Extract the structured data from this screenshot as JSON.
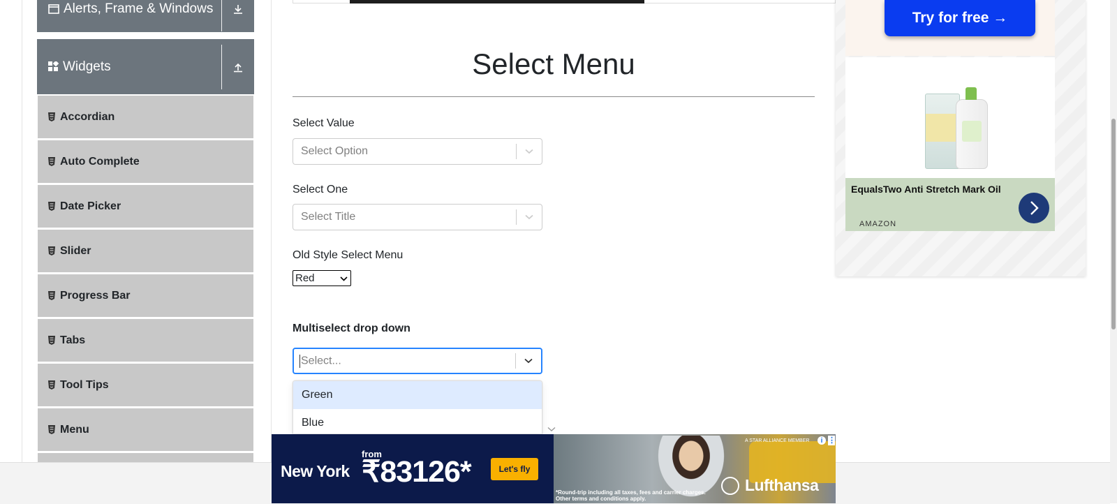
{
  "sidebar": {
    "groups": [
      {
        "title": "Alerts, Frame & Windows",
        "icon": "window-icon",
        "arrow": "download-arrow-icon"
      },
      {
        "title": "Widgets",
        "icon": "widgets-grid-icon",
        "arrow": "upload-arrow-icon"
      }
    ],
    "items": [
      {
        "label": "Accordian"
      },
      {
        "label": "Auto Complete"
      },
      {
        "label": "Date Picker"
      },
      {
        "label": "Slider"
      },
      {
        "label": "Progress Bar"
      },
      {
        "label": "Tabs"
      },
      {
        "label": "Tool Tips"
      },
      {
        "label": "Menu"
      }
    ]
  },
  "main": {
    "title": "Select Menu",
    "select_value": {
      "label": "Select Value",
      "placeholder": "Select Option"
    },
    "select_one": {
      "label": "Select One",
      "placeholder": "Select Title"
    },
    "old_style": {
      "label": "Old Style Select Menu",
      "selected": "Red"
    },
    "multiselect": {
      "label": "Multiselect drop down",
      "placeholder": "Select...",
      "options": [
        "Green",
        "Blue"
      ],
      "highlighted": "Green"
    }
  },
  "ads": {
    "right": {
      "cta": "Try for free →",
      "product_name": "EqualsTwo Anti Stretch Mark Oil",
      "brand": "AMAZON"
    },
    "bottom": {
      "from": "from",
      "city": "New York",
      "price": "₹83126*",
      "cta": "Let's fly",
      "alliance": "A STAR ALLIANCE MEMBER",
      "fine_print_1": "*Round-trip including all taxes, fees and carrier charges.",
      "fine_print_2": "Other terms and conditions apply.",
      "airline": "Lufthansa"
    }
  },
  "colors": {
    "sidebar_group": "#6c757d",
    "sidebar_item": "#c8c8c8",
    "focus_border": "#2684ff",
    "option_highlight": "#deebff",
    "cta_blue": "#0a3cf0"
  }
}
